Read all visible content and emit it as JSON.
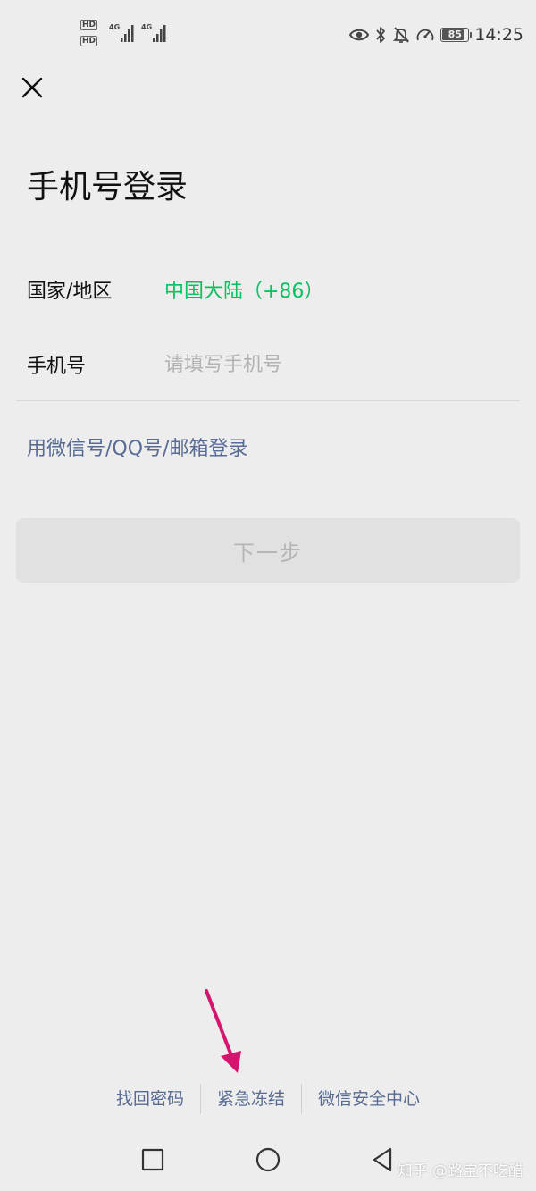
{
  "status_bar": {
    "hd_labels": [
      "HD",
      "HD"
    ],
    "network_labels": [
      "4G",
      "4G"
    ],
    "icons": [
      "eye-icon",
      "bluetooth-icon",
      "bell-off-icon",
      "speedometer-icon"
    ],
    "battery_level": 85,
    "battery_text": "85",
    "time": "14:25"
  },
  "header": {
    "close_icon": "close-icon",
    "title": "手机号登录"
  },
  "form": {
    "region_label": "国家/地区",
    "region_value": "中国大陆（+86）",
    "phone_label": "手机号",
    "phone_value": "",
    "phone_placeholder": "请填写手机号"
  },
  "alt_login": "用微信号/QQ号/邮箱登录",
  "next_button": "下一步",
  "footer_links": [
    "找回密码",
    "紧急冻结",
    "微信安全中心"
  ],
  "annotation": {
    "icon": "arrow-icon"
  },
  "nav_bar": {
    "icons": [
      "recent-apps-icon",
      "home-icon",
      "back-icon"
    ]
  },
  "watermark": "知乎 @路宝不吃醋",
  "colors": {
    "background": "#ededed",
    "accent_green": "#07c160",
    "link_blue": "#576b95",
    "annotation_arrow": "#d6146f",
    "button_disabled_bg": "#e1e1e1",
    "button_disabled_text": "#b5b5b5"
  }
}
